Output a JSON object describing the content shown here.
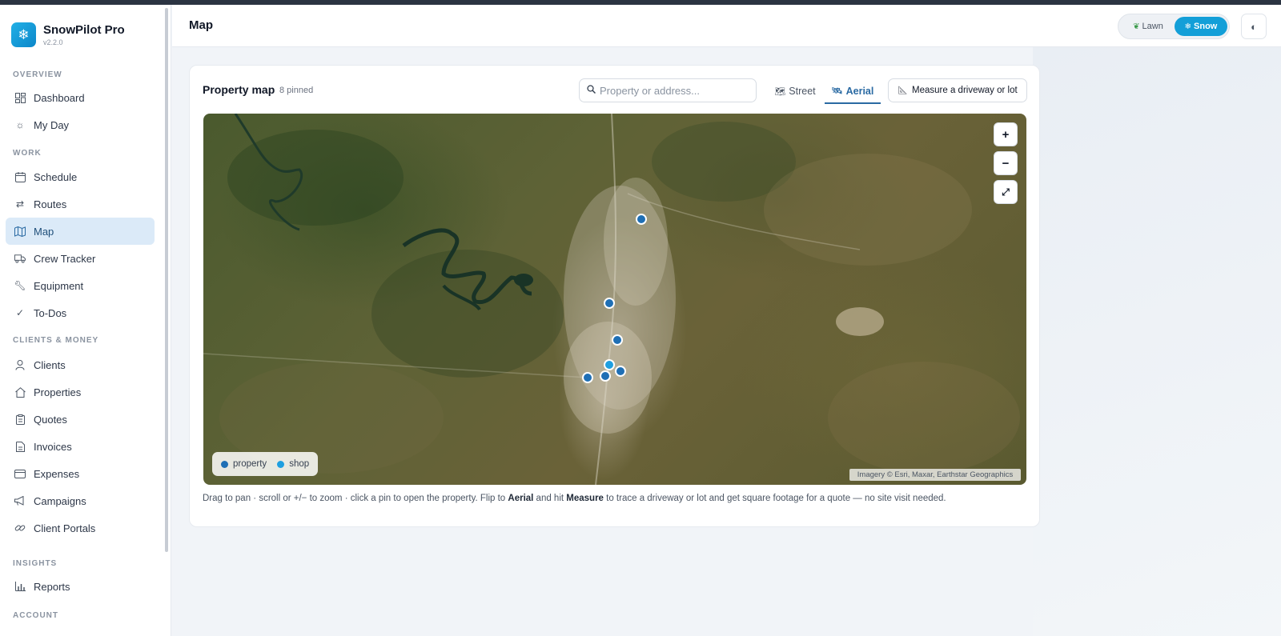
{
  "app": {
    "name": "SnowPilot Pro",
    "version": "v2.2.0",
    "logo_glyph": "❄"
  },
  "sidebar": {
    "sections": [
      {
        "label": "OVERVIEW"
      },
      {
        "label": "WORK"
      },
      {
        "label": "CLIENTS & MONEY"
      },
      {
        "label": "INSIGHTS"
      },
      {
        "label": "ACCOUNT"
      }
    ],
    "items": [
      {
        "label": "Dashboard",
        "icon": "dashboard-icon"
      },
      {
        "label": "My Day",
        "icon": "sun-icon"
      },
      {
        "label": "Schedule",
        "icon": "calendar-icon"
      },
      {
        "label": "Routes",
        "icon": "routes-icon"
      },
      {
        "label": "Map",
        "icon": "map-icon",
        "active": true
      },
      {
        "label": "Crew Tracker",
        "icon": "truck-icon"
      },
      {
        "label": "Equipment",
        "icon": "wrench-icon"
      },
      {
        "label": "To-Dos",
        "icon": "check-icon"
      },
      {
        "label": "Clients",
        "icon": "person-icon"
      },
      {
        "label": "Properties",
        "icon": "home-icon"
      },
      {
        "label": "Quotes",
        "icon": "clipboard-icon"
      },
      {
        "label": "Invoices",
        "icon": "document-icon"
      },
      {
        "label": "Expenses",
        "icon": "card-icon"
      },
      {
        "label": "Campaigns",
        "icon": "megaphone-icon"
      },
      {
        "label": "Client Portals",
        "icon": "link-icon"
      },
      {
        "label": "Reports",
        "icon": "bar-chart-icon"
      }
    ]
  },
  "header": {
    "title": "Map",
    "mode": {
      "lawn": "Lawn",
      "snow": "Snow",
      "active": "snow"
    }
  },
  "card": {
    "title": "Property map",
    "subtitle": "8 pinned",
    "search_placeholder": "Property or address...",
    "tabs": {
      "street": "Street",
      "aerial": "Aerial",
      "active": "aerial"
    },
    "measure_label": "Measure a driveway or lot"
  },
  "map": {
    "zoom_in": "+",
    "zoom_out": "−",
    "fullscreen": "⤢",
    "legend": [
      {
        "label": "property",
        "color": "#1f6fb5"
      },
      {
        "label": "shop",
        "color": "#1e9fe0"
      }
    ],
    "attribution": "Imagery © Esri, Maxar, Earthstar Geographics"
  },
  "hint": {
    "part1": "Drag to pan · scroll or +/− to zoom · click a pin to open the property. Flip to ",
    "bold1": "Aerial",
    "part2": " and hit ",
    "bold2": "Measure",
    "part3": " to trace a driveway or lot and get square footage for a quote — no site visit needed."
  },
  "colors": {
    "accent": "#139fd8",
    "active_nav_bg": "#dbeaf8",
    "pin": "#1f6fb5"
  }
}
